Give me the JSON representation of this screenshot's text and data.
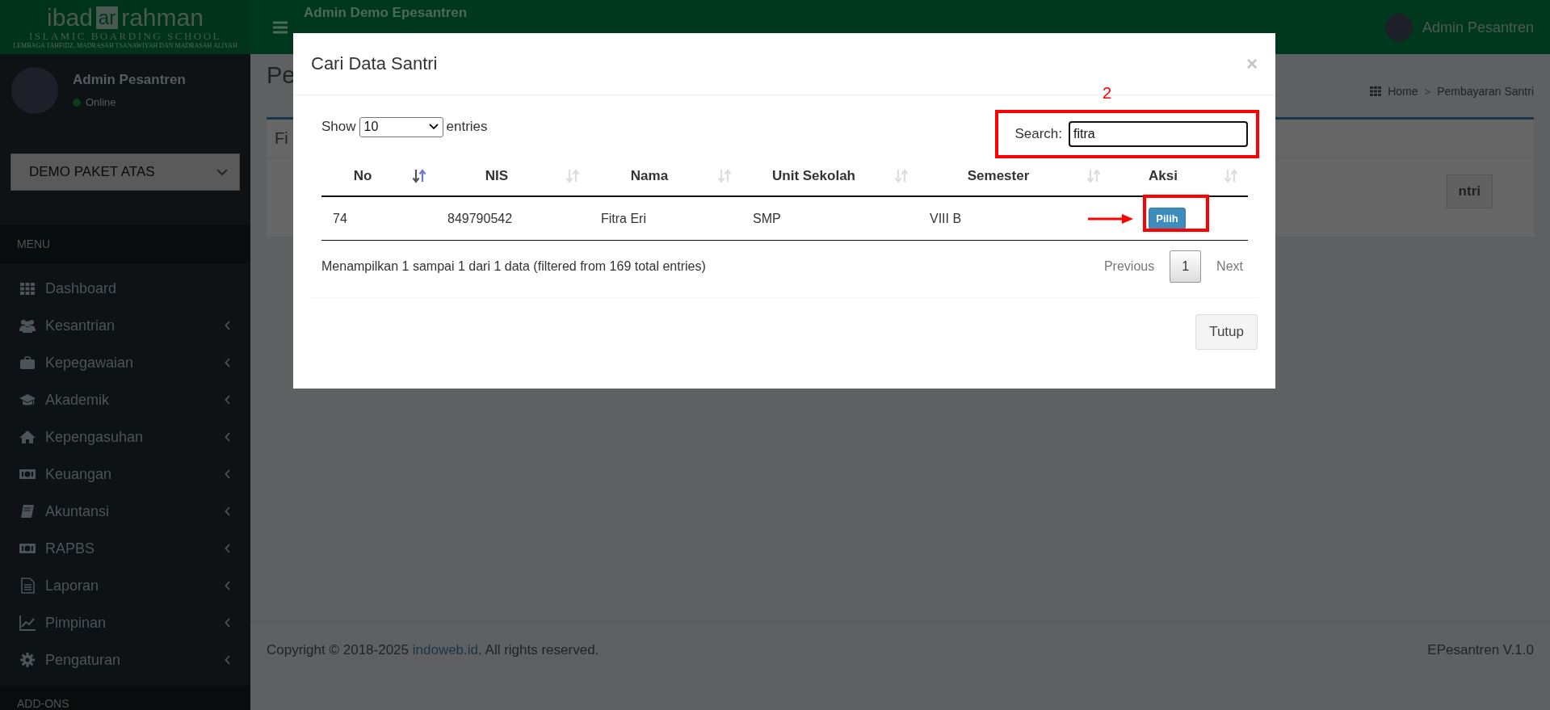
{
  "header": {
    "logo": {
      "part_1": "ibad",
      "part_2": "ar",
      "part_3": "rahman",
      "subtitle": "ISLAMIC BOARDING SCHOOL",
      "tagline": "LEMBAGA TAHFIDZ, MADRASAH TSANAWIYAH DAN MADRASAH ALIYAH"
    },
    "title": "Admin Demo Epesantren",
    "user_name": "Admin Pesantren"
  },
  "sidebar": {
    "user": {
      "name": "Admin Pesantren",
      "status": "Online"
    },
    "unit_select": {
      "value": "DEMO PAKET ATAS"
    },
    "menu_header": "MENU",
    "items": [
      {
        "label": "Dashboard",
        "expandable": false
      },
      {
        "label": "Kesantrian",
        "expandable": true
      },
      {
        "label": "Kepegawaian",
        "expandable": true
      },
      {
        "label": "Akademik",
        "expandable": true
      },
      {
        "label": "Kepengasuhan",
        "expandable": true
      },
      {
        "label": "Keuangan",
        "expandable": true
      },
      {
        "label": "Akuntansi",
        "expandable": true
      },
      {
        "label": "RAPBS",
        "expandable": true
      },
      {
        "label": "Laporan",
        "expandable": true
      },
      {
        "label": "Pimpinan",
        "expandable": true
      },
      {
        "label": "Pengaturan",
        "expandable": true
      }
    ],
    "addons_header": "ADD-ONS"
  },
  "page": {
    "title_partial": "Pe",
    "breadcrumb": [
      "Home",
      "Pembayaran Santri"
    ],
    "breadcrumb_separator": ">",
    "box_title_partial": "Fi",
    "button_partial": "ntri"
  },
  "footer": {
    "copyright_prefix": "Copyright © 2018-2025 ",
    "link": "indoweb.id",
    "copyright_suffix": ". All rights reserved.",
    "version": "EPesantren V.1.0"
  },
  "modal": {
    "title": "Cari Data Santri",
    "close": "×",
    "length_menu": {
      "prefix": "Show",
      "value": "10",
      "suffix": "entries"
    },
    "search": {
      "label": "Search:",
      "value": "fitra"
    },
    "table": {
      "columns": [
        {
          "label": "No",
          "sorted_ascending": true
        },
        {
          "label": "NIS",
          "sorted_ascending": false
        },
        {
          "label": "Nama",
          "sorted_ascending": false
        },
        {
          "label": "Unit Sekolah",
          "sorted_ascending": false
        },
        {
          "label": "Semester",
          "sorted_ascending": false
        },
        {
          "label": "Aksi",
          "sorted_ascending": false
        }
      ],
      "rows": [
        {
          "cells": [
            "74",
            "849790542",
            "Fitra Eri",
            "SMP",
            "VIII B"
          ],
          "action": "Pilih"
        }
      ]
    },
    "info": "Menampilkan 1 sampai 1 dari 1 data (filtered from 169 total entries)",
    "pagination": [
      {
        "label": "Previous",
        "selected": false,
        "disabled": true
      },
      {
        "label": "1",
        "selected": true,
        "disabled": false
      },
      {
        "label": "Next",
        "selected": false,
        "disabled": true
      }
    ],
    "close_button": "Tutup"
  },
  "annotations": {
    "step_label": "2"
  }
}
